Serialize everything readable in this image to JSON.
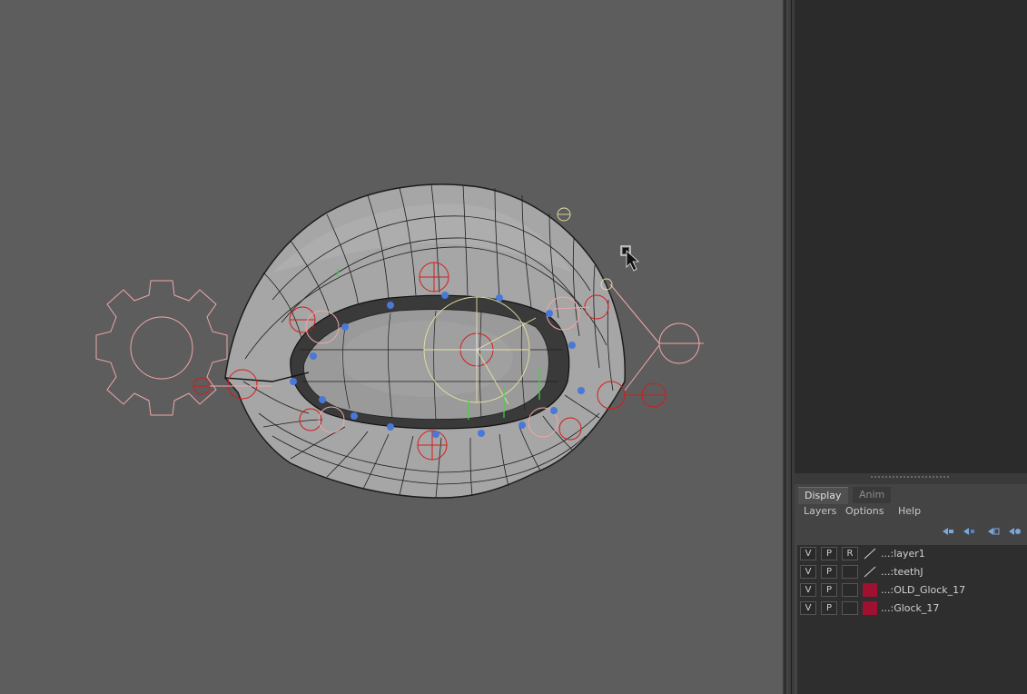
{
  "viewport": {
    "name": "3d-viewport",
    "background": "#5d5d5d",
    "mesh_color": "#a4a4a4",
    "wire_color": "#1e1e1e",
    "ctrl_red": "#d41c1c",
    "ctrl_pink": "#f0a7a7",
    "ctrl_blue": "#4a78d8",
    "ctrl_yellow": "#e8e0a0",
    "ctrl_green": "#3cd83c"
  },
  "layer_editor": {
    "tabs": [
      {
        "label": "Display",
        "active": true
      },
      {
        "label": "Anim",
        "active": false
      }
    ],
    "menus": [
      "Layers",
      "Options",
      "Help"
    ],
    "toolbar_icons": [
      "move-layer-up-icon",
      "move-layer-down-icon",
      "new-empty-layer-icon",
      "new-layer-selected-icon"
    ],
    "layers": [
      {
        "v": "V",
        "p": "P",
        "r": "R",
        "swatch": "none",
        "name": "...:layer1"
      },
      {
        "v": "V",
        "p": "P",
        "r": "",
        "swatch": "none",
        "name": "...:teethJ"
      },
      {
        "v": "V",
        "p": "P",
        "r": "",
        "swatch": "#a01030",
        "name": "...:OLD_Glock_17"
      },
      {
        "v": "V",
        "p": "P",
        "r": "",
        "swatch": "#a01030",
        "name": "...:Glock_17"
      }
    ]
  }
}
